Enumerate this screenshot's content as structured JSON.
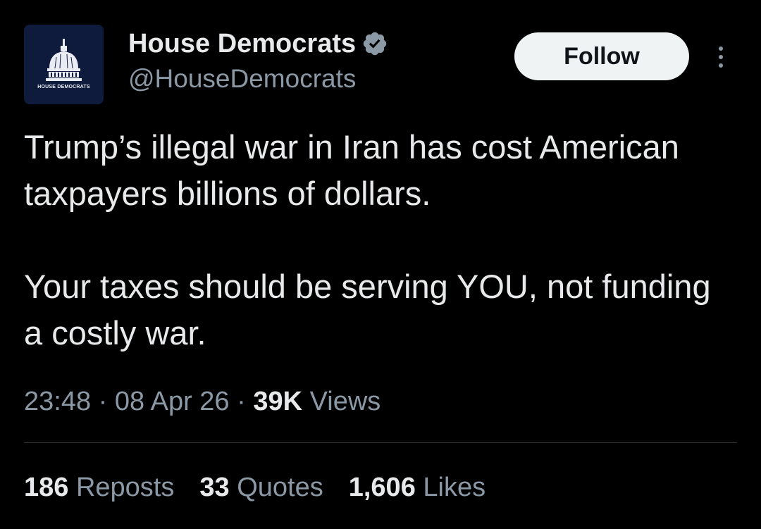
{
  "author": {
    "avatar_caption": "HOUSE DEMOCRATS",
    "display_name": "House Democrats",
    "handle": "@HouseDemocrats",
    "verified_icon": "verified-badge-icon"
  },
  "actions": {
    "follow_label": "Follow",
    "more_icon": "more-vertical-icon"
  },
  "tweet": {
    "paragraphs": [
      "Trump’s illegal war in Iran has cost American taxpayers billions of dollars.",
      "Your taxes should be serving YOU, not funding a costly war."
    ]
  },
  "meta": {
    "time": "23:48",
    "separator": " · ",
    "date": "08 Apr 26",
    "views_count": "39K",
    "views_label": " Views"
  },
  "stats": {
    "reposts_count": "186",
    "reposts_label": " Reposts",
    "quotes_count": "33",
    "quotes_label": " Quotes",
    "likes_count": "1,606",
    "likes_label": " Likes"
  },
  "colors": {
    "background": "#000000",
    "primary_text": "#e7e9ea",
    "secondary_text": "#8b98a5",
    "follow_bg": "#eff3f4",
    "verified": "#8b98a5",
    "avatar_bg": "#0f1b3d"
  }
}
